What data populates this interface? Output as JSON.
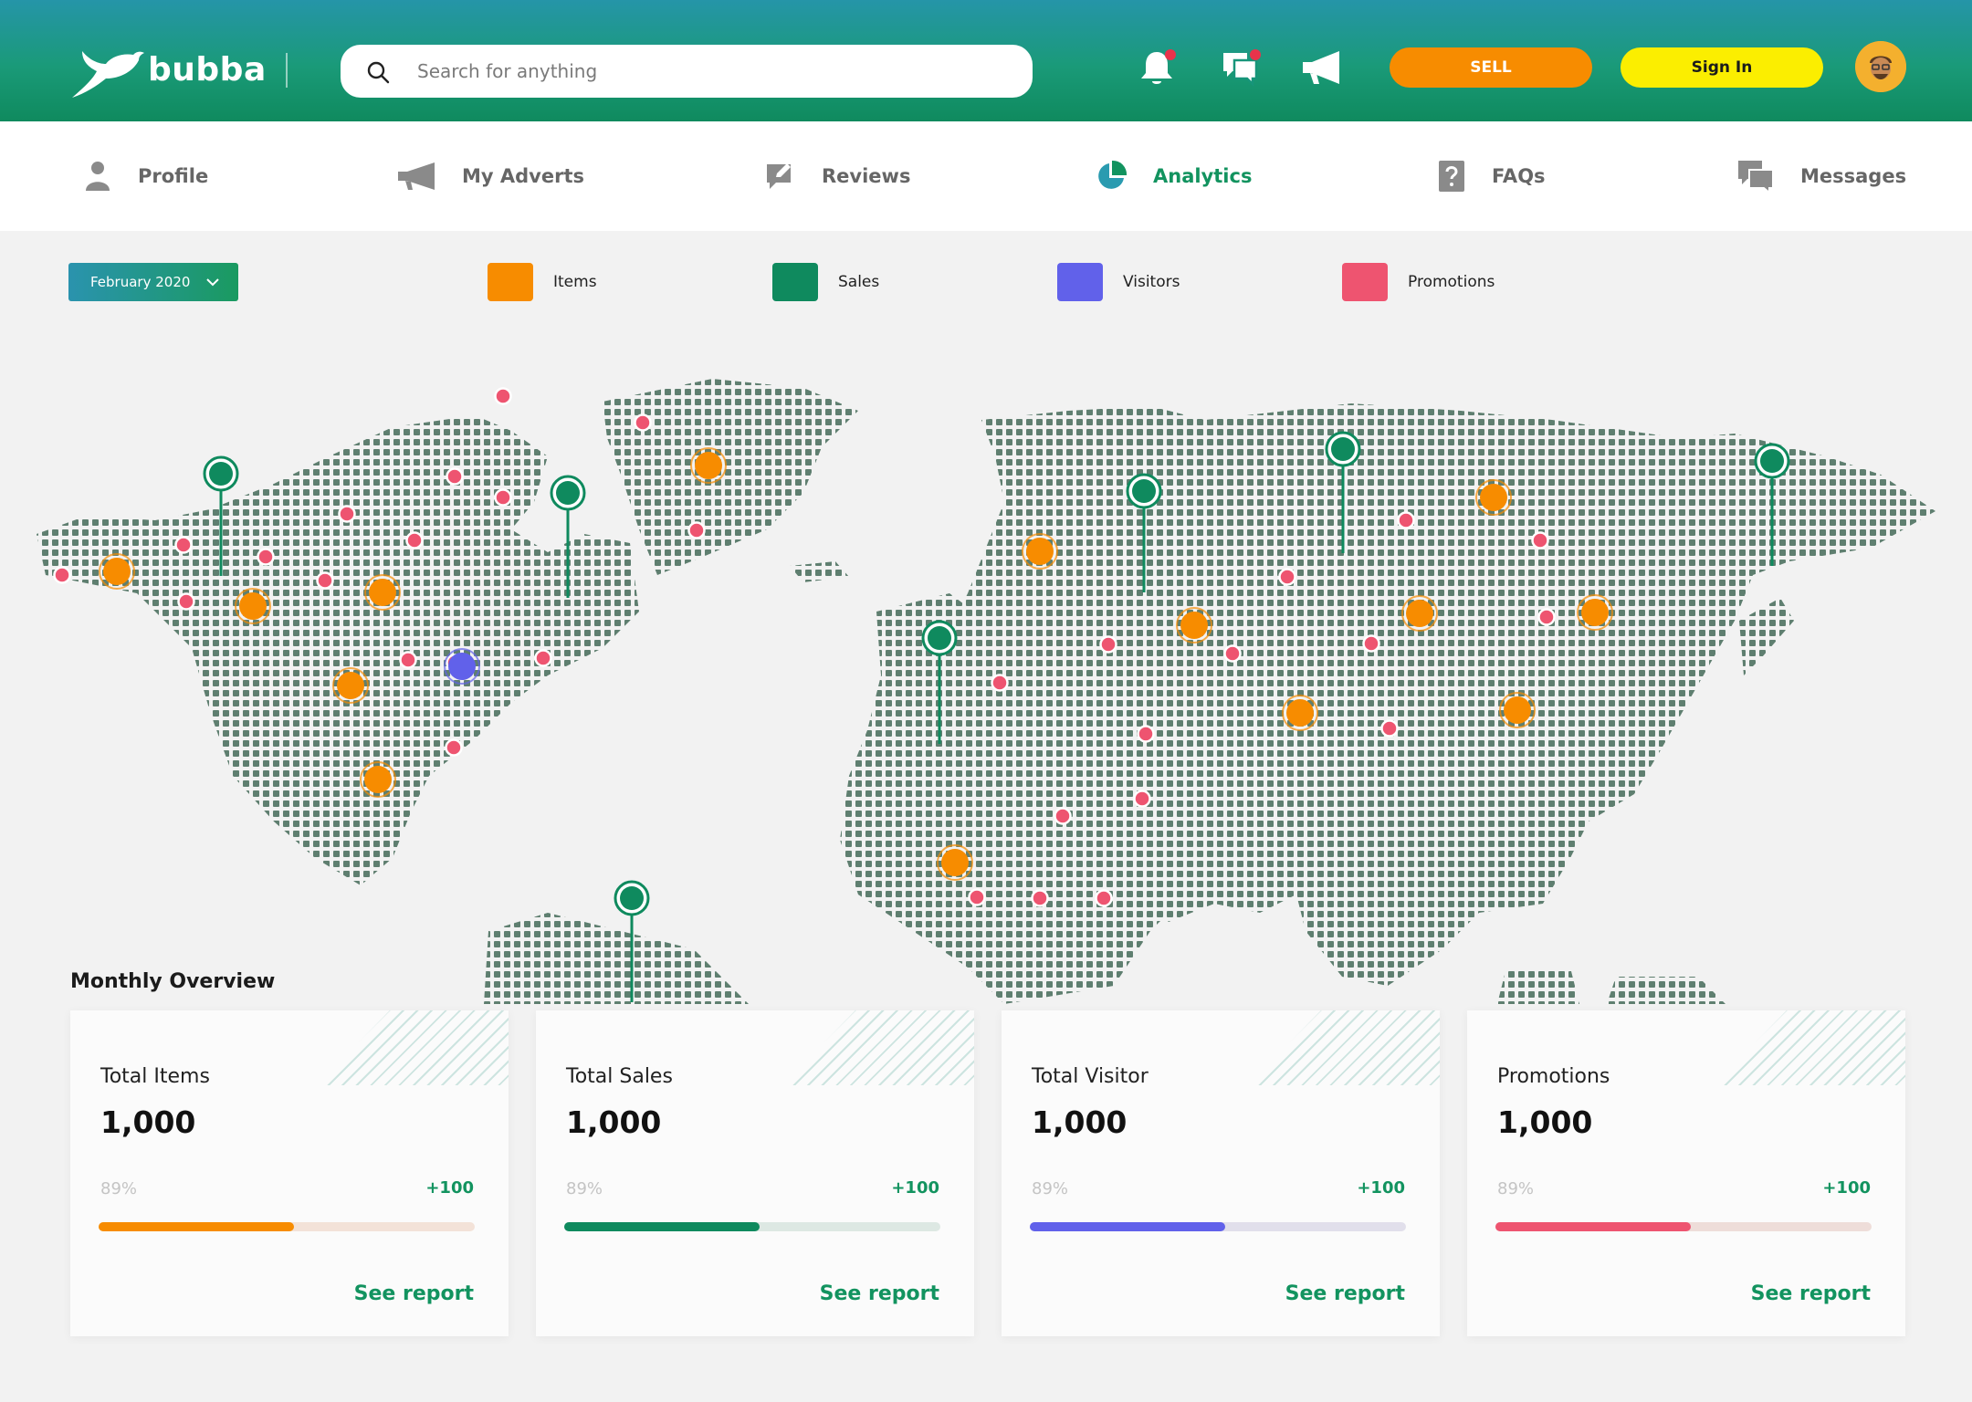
{
  "app": {
    "name": "bubba"
  },
  "header": {
    "search_placeholder": "Search for anything",
    "sell_label": "SELL",
    "signin_label": "Sign In"
  },
  "nav": {
    "items": [
      {
        "label": "Profile",
        "icon": "user-icon",
        "active": false
      },
      {
        "label": "My Adverts",
        "icon": "megaphone-icon",
        "active": false
      },
      {
        "label": "Reviews",
        "icon": "edit-review-icon",
        "active": false
      },
      {
        "label": "Analytics",
        "icon": "pie-chart-icon",
        "active": true
      },
      {
        "label": "FAQs",
        "icon": "faq-icon",
        "active": false
      },
      {
        "label": "Messages",
        "icon": "chat-icon",
        "active": false
      }
    ]
  },
  "filters": {
    "month": "February 2020",
    "legend": [
      {
        "label": "Items",
        "color": "#f78c00"
      },
      {
        "label": "Sales",
        "color": "#0f8a5e"
      },
      {
        "label": "Visitors",
        "color": "#6161ea"
      },
      {
        "label": "Promotions",
        "color": "#ee5470"
      }
    ]
  },
  "overview": {
    "title": "Monthly Overview",
    "cards": [
      {
        "label": "Total Items",
        "value": "1,000",
        "percent": "89%",
        "delta": "+100",
        "progress_fraction": 0.52,
        "link": "See report",
        "color": "#f78c00",
        "track": "#f3e2d8"
      },
      {
        "label": "Total Sales",
        "value": "1,000",
        "percent": "89%",
        "delta": "+100",
        "progress_fraction": 0.52,
        "link": "See report",
        "color": "#0f8a5e",
        "track": "#dde8e3"
      },
      {
        "label": "Total Visitor",
        "value": "1,000",
        "percent": "89%",
        "delta": "+100",
        "progress_fraction": 0.52,
        "link": "See report",
        "color": "#6161ea",
        "track": "#e1dfeb"
      },
      {
        "label": "Promotions",
        "value": "1,000",
        "percent": "89%",
        "delta": "+100",
        "progress_fraction": 0.52,
        "link": "See report",
        "color": "#ee5470",
        "track": "#eeddd9"
      }
    ]
  },
  "colors": {
    "accent": "#12935f",
    "brand_gradient_top": "#2595a8",
    "brand_gradient_bottom": "#0f8a5e"
  }
}
